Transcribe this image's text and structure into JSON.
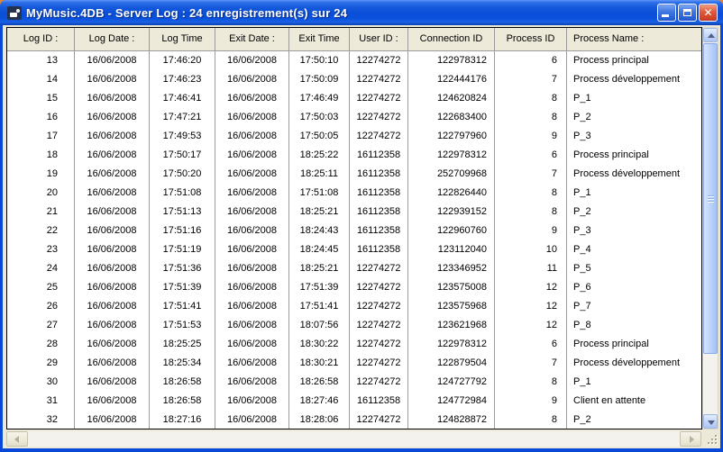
{
  "window": {
    "title": "MyMusic.4DB - Server Log : 24 enregistrement(s) sur 24",
    "record_count": 24,
    "records_shown": 24,
    "controls": [
      {
        "name": "minimize"
      },
      {
        "name": "maximize"
      },
      {
        "name": "close"
      }
    ]
  },
  "colors": {
    "titlebar_blue": "#0A4ED8",
    "window_border_blue": "#0848D8",
    "close_button_red": "#E0593A",
    "client_beige": "#ECE9D8",
    "header_beige": "#EDEADA",
    "grid_line_gray": "#9B9B9B",
    "scrollbar_thumb_blue": "#BED5FB"
  },
  "table": {
    "columns": [
      "Log ID :",
      "Log Date :",
      "Log Time",
      "Exit Date :",
      "Exit Time",
      "User ID :",
      "Connection ID",
      "Process ID",
      "Process Name :"
    ],
    "rows": [
      [
        "13",
        "16/06/2008",
        "17:46:20",
        "16/06/2008",
        "17:50:10",
        "12274272",
        "122978312",
        "6",
        "Process principal"
      ],
      [
        "14",
        "16/06/2008",
        "17:46:23",
        "16/06/2008",
        "17:50:09",
        "12274272",
        "122444176",
        "7",
        "Process développement"
      ],
      [
        "15",
        "16/06/2008",
        "17:46:41",
        "16/06/2008",
        "17:46:49",
        "12274272",
        "124620824",
        "8",
        "P_1"
      ],
      [
        "16",
        "16/06/2008",
        "17:47:21",
        "16/06/2008",
        "17:50:03",
        "12274272",
        "122683400",
        "8",
        "P_2"
      ],
      [
        "17",
        "16/06/2008",
        "17:49:53",
        "16/06/2008",
        "17:50:05",
        "12274272",
        "122797960",
        "9",
        "P_3"
      ],
      [
        "18",
        "16/06/2008",
        "17:50:17",
        "16/06/2008",
        "18:25:22",
        "16112358",
        "122978312",
        "6",
        "Process principal"
      ],
      [
        "19",
        "16/06/2008",
        "17:50:20",
        "16/06/2008",
        "18:25:11",
        "16112358",
        "252709968",
        "7",
        "Process développement"
      ],
      [
        "20",
        "16/06/2008",
        "17:51:08",
        "16/06/2008",
        "17:51:08",
        "16112358",
        "122826440",
        "8",
        "P_1"
      ],
      [
        "21",
        "16/06/2008",
        "17:51:13",
        "16/06/2008",
        "18:25:21",
        "16112358",
        "122939152",
        "8",
        "P_2"
      ],
      [
        "22",
        "16/06/2008",
        "17:51:16",
        "16/06/2008",
        "18:24:43",
        "16112358",
        "122960760",
        "9",
        "P_3"
      ],
      [
        "23",
        "16/06/2008",
        "17:51:19",
        "16/06/2008",
        "18:24:45",
        "16112358",
        "123112040",
        "10",
        "P_4"
      ],
      [
        "24",
        "16/06/2008",
        "17:51:36",
        "16/06/2008",
        "18:25:21",
        "12274272",
        "123346952",
        "11",
        "P_5"
      ],
      [
        "25",
        "16/06/2008",
        "17:51:39",
        "16/06/2008",
        "17:51:39",
        "12274272",
        "123575008",
        "12",
        "P_6"
      ],
      [
        "26",
        "16/06/2008",
        "17:51:41",
        "16/06/2008",
        "17:51:41",
        "12274272",
        "123575968",
        "12",
        "P_7"
      ],
      [
        "27",
        "16/06/2008",
        "17:51:53",
        "16/06/2008",
        "18:07:56",
        "12274272",
        "123621968",
        "12",
        "P_8"
      ],
      [
        "28",
        "16/06/2008",
        "18:25:25",
        "16/06/2008",
        "18:30:22",
        "12274272",
        "122978312",
        "6",
        "Process principal"
      ],
      [
        "29",
        "16/06/2008",
        "18:25:34",
        "16/06/2008",
        "18:30:21",
        "12274272",
        "122879504",
        "7",
        "Process développement"
      ],
      [
        "30",
        "16/06/2008",
        "18:26:58",
        "16/06/2008",
        "18:26:58",
        "12274272",
        "124727792",
        "8",
        "P_1"
      ],
      [
        "31",
        "16/06/2008",
        "18:26:58",
        "16/06/2008",
        "18:27:46",
        "16112358",
        "124772984",
        "9",
        "Client en attente"
      ],
      [
        "32",
        "16/06/2008",
        "18:27:16",
        "16/06/2008",
        "18:28:06",
        "12274272",
        "124828872",
        "8",
        "P_2"
      ]
    ]
  }
}
